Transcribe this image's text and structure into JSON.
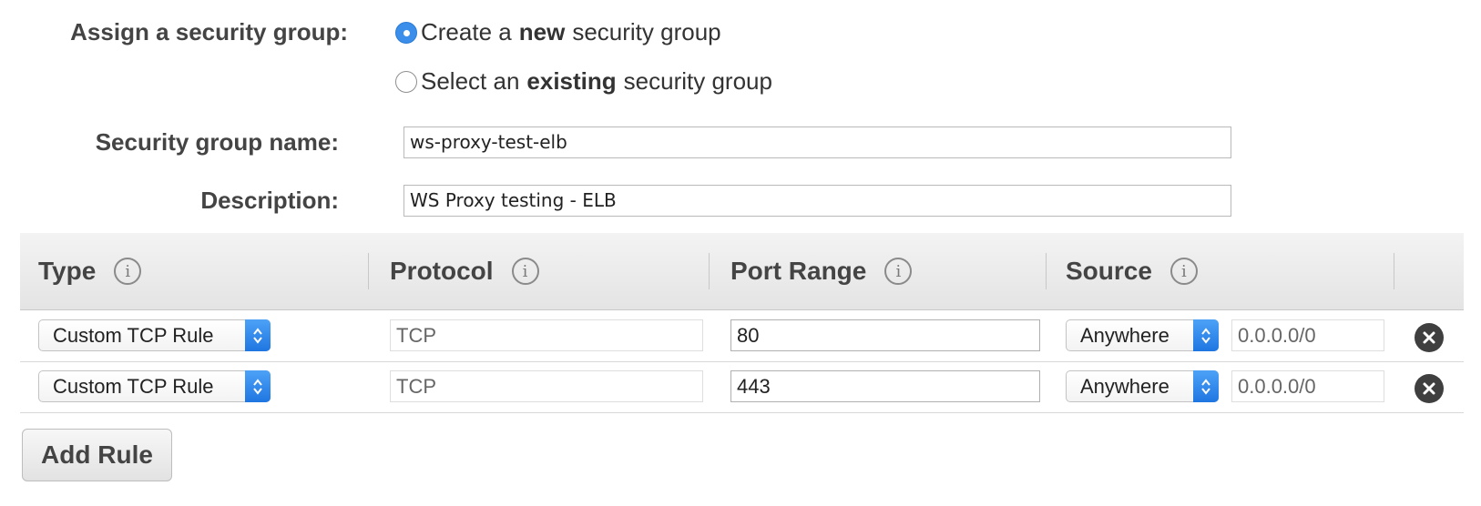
{
  "assign": {
    "label": "Assign a security group:",
    "option_new": {
      "pre": "Create a",
      "bold": "new",
      "post": "security group",
      "selected": true
    },
    "option_existing": {
      "pre": "Select an",
      "bold": "existing",
      "post": "security group",
      "selected": false
    }
  },
  "group_name": {
    "label": "Security group name:",
    "value": "ws-proxy-test-elb"
  },
  "description": {
    "label": "Description:",
    "value": "WS Proxy testing - ELB"
  },
  "table": {
    "headers": {
      "type": "Type",
      "protocol": "Protocol",
      "port_range": "Port Range",
      "source": "Source"
    },
    "info_icon": "info-icon",
    "rows": [
      {
        "type": "Custom TCP Rule",
        "protocol": "TCP",
        "port": "80",
        "source": "Anywhere",
        "cidr": "0.0.0.0/0"
      },
      {
        "type": "Custom TCP Rule",
        "protocol": "TCP",
        "port": "443",
        "source": "Anywhere",
        "cidr": "0.0.0.0/0"
      }
    ]
  },
  "add_rule": "Add Rule",
  "colors": {
    "accent": "#3b8fea",
    "header_bg": "#e9e9e9",
    "delete_icon": "#3f3f3f"
  }
}
